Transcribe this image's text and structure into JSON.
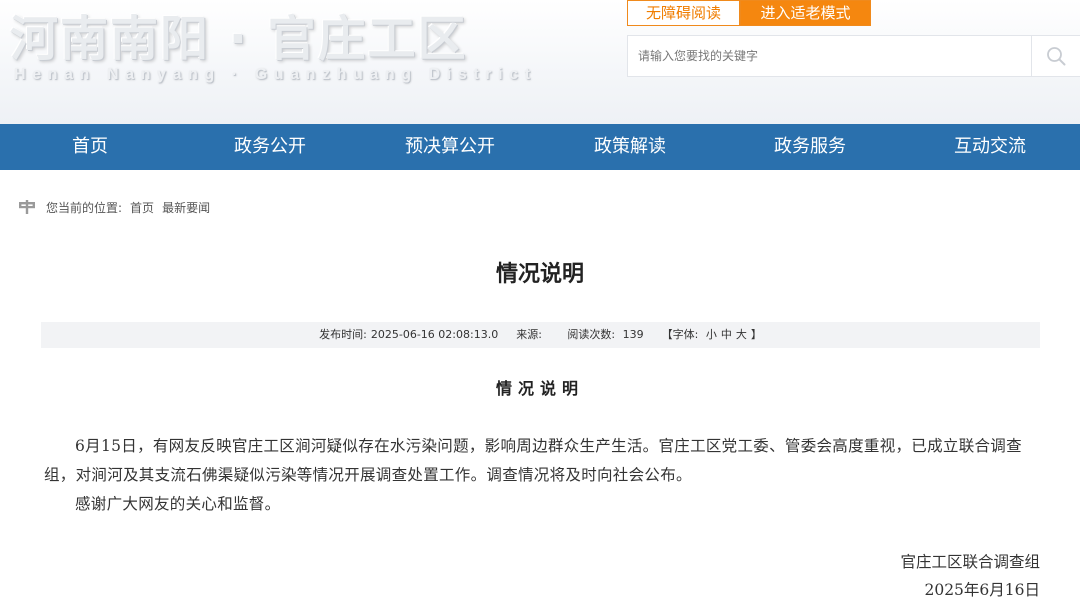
{
  "header": {
    "logo_cn": "河南南阳 · 官庄工区",
    "logo_en": "Henan Nanyang · Guanzhuang District",
    "accessibility_label": "无障碍阅读",
    "elder_mode_label": "进入适老模式",
    "search": {
      "placeholder": "请输入您要找的关键字",
      "value": "",
      "icon": "search-icon"
    }
  },
  "nav": {
    "items": [
      {
        "label": "首页"
      },
      {
        "label": "政务公开"
      },
      {
        "label": "预决算公开"
      },
      {
        "label": "政策解读"
      },
      {
        "label": "政务服务"
      },
      {
        "label": "互动交流"
      }
    ]
  },
  "breadcrumb": {
    "prefix": "您当前的位置:",
    "home": "首页",
    "current": "最新要闻",
    "icon": "location-pin-icon"
  },
  "article": {
    "title": "情况说明",
    "meta": {
      "publish_label": "发布时间:",
      "publish_time": "2025-06-16 02:08:13.0",
      "source_label": "来源:",
      "source": "",
      "views_label": "阅读次数:",
      "views": "139",
      "font_label": "【字体:",
      "font_small": "小",
      "font_medium": "中",
      "font_large": "大",
      "font_close": "】"
    },
    "subtitle": "情况说明",
    "paragraphs": [
      "6月15日，有网友反映官庄工区涧河疑似存在水污染问题，影响周边群众生产生活。官庄工区党工委、管委会高度重视，已成立联合调查组，对涧河及其支流石佛渠疑似污染等情况开展调查处置工作。调查情况将及时向社会公布。",
      "感谢广大网友的关心和监督。"
    ],
    "signature": "官庄工区联合调查组",
    "date": "2025年6月16日"
  },
  "colors": {
    "nav_bg": "#2a70ad",
    "accent_orange": "#f5870f",
    "meta_bg": "#f2f3f5"
  }
}
